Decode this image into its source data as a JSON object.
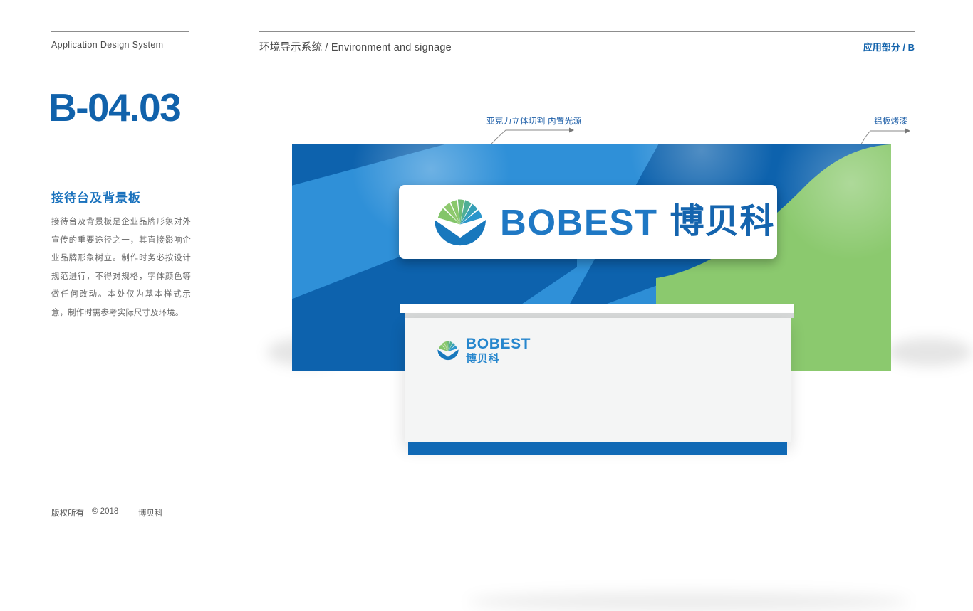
{
  "sidebar": {
    "eyebrow": "Application Design System",
    "page_code": "B-04.03",
    "section_title": "接待台及背景板",
    "section_body": "接待台及背景板是企业品牌形象对外宣传的重要途径之一，其直接影响企业品牌形象树立。制作时务必按设计规范进行，不得对规格，字体颜色等做任何改动。本处仅为基本样式示意，制作时需参考实际尺寸及环境。",
    "footer": {
      "copyright_label": "版权所有",
      "copyright_year": "© 2018",
      "brand": "博贝科"
    }
  },
  "header": {
    "left_title": "环境导示系统 / Environment and signage",
    "right_title": "应用部分 / B"
  },
  "annotations": [
    {
      "id": "acrylic",
      "label": "亚克力立体切割  内置光源"
    },
    {
      "id": "aluminum",
      "label": "铝板烤漆"
    }
  ],
  "scene": {
    "signboard": {
      "wordmark": "BOBEST",
      "chinese": "博贝科"
    },
    "desk": {
      "wordmark": "BOBEST",
      "chinese": "博贝科"
    }
  },
  "colors": {
    "brand_blue": "#1162ab",
    "backdrop_blue": "#0d62ad",
    "light_blue": "#2f90d8",
    "brand_green": "#8bc96e",
    "desk_base_blue": "#1069b5",
    "rule_gray": "#8d8d8d",
    "body_text_gray": "#6a6a6a"
  }
}
